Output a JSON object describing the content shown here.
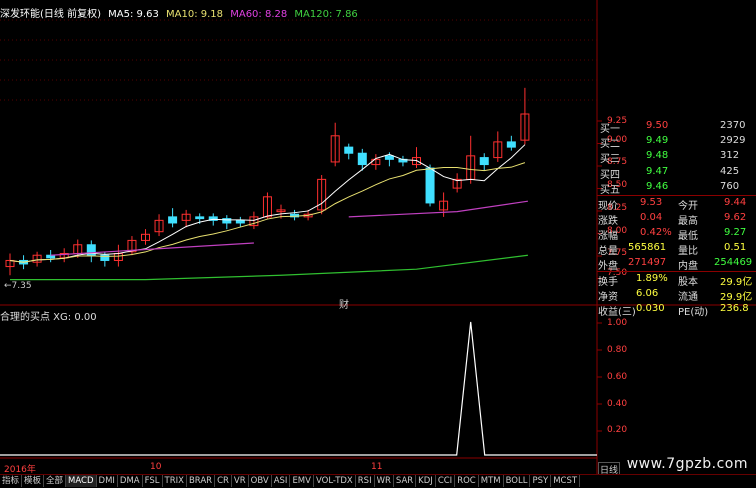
{
  "header": {
    "title": "深发环能(日线 前复权)",
    "ma5": "MA5: 9.63",
    "ma10": "MA10: 9.18",
    "ma60": "MA60: 8.28",
    "ma120": "MA120: 7.86"
  },
  "colors": {
    "up": "#ff3030",
    "down": "#40e0ff",
    "ma5": "#ffffff",
    "ma10": "#e8e070",
    "ma60": "#c040c0",
    "ma120": "#30c030",
    "grid": "#8b0000"
  },
  "price_axis": [
    "9.25",
    "9.00",
    "8.75",
    "8.50",
    "8.25",
    "8.00",
    "7.75",
    "7.50"
  ],
  "low_marker": "←7.35",
  "cai_label": "财",
  "indicator": {
    "title": "合理的买点 XG: 0.00",
    "axis": [
      "1.00",
      "0.80",
      "0.60",
      "0.40",
      "0.20"
    ]
  },
  "date_axis": {
    "year": "2016年",
    "m10": "10",
    "m11": "11"
  },
  "quote": {
    "bids": [
      {
        "label": "买一",
        "price": "9.50",
        "vol": "2370"
      },
      {
        "label": "买二",
        "price": "9.49",
        "vol": "2929"
      },
      {
        "label": "买三",
        "price": "9.48",
        "vol": "312"
      },
      {
        "label": "买四",
        "price": "9.47",
        "vol": "425"
      },
      {
        "label": "买五",
        "price": "9.46",
        "vol": "760"
      }
    ],
    "stats": [
      {
        "l1": "现价",
        "v1": "9.53",
        "l2": "今开",
        "v2": "9.44"
      },
      {
        "l1": "涨跌",
        "v1": "0.04",
        "l2": "最高",
        "v2": "9.62"
      },
      {
        "l1": "涨幅",
        "v1": "0.42%",
        "l2": "最低",
        "v2": "9.27"
      },
      {
        "l1": "总量",
        "v1": "565861",
        "l2": "量比",
        "v2": "0.51"
      },
      {
        "l1": "外盘",
        "v1": "271497",
        "l2": "内盘",
        "v2": "254469"
      }
    ],
    "stats2": [
      {
        "l1": "换手",
        "v1": "1.89%",
        "l2": "股本",
        "v2": "29.9亿"
      },
      {
        "l1": "净资",
        "v1": "6.06",
        "l2": "流通",
        "v2": "29.9亿"
      },
      {
        "l1": "收益(三)",
        "v1": "0.030",
        "l2": "PE(动)",
        "v2": "236.8"
      }
    ]
  },
  "tabs": [
    "指标",
    "模板",
    "全部",
    "MACD",
    "DMI",
    "DMA",
    "FSL",
    "TRIX",
    "BRAR",
    "CR",
    "VR",
    "OBV",
    "ASI",
    "EMV",
    "VOL-TDX",
    "RSI",
    "WR",
    "SAR",
    "KDJ",
    "CCI",
    "ROC",
    "MTM",
    "BOLL",
    "PSY",
    "MCST"
  ],
  "side_tab": "日线",
  "watermark": "www.7gpzb.com",
  "chart_data": {
    "type": "candlestick",
    "candles": [
      {
        "o": 7.55,
        "c": 7.62,
        "h": 7.7,
        "l": 7.45
      },
      {
        "o": 7.62,
        "c": 7.58,
        "h": 7.68,
        "l": 7.52
      },
      {
        "o": 7.6,
        "c": 7.68,
        "h": 7.72,
        "l": 7.55
      },
      {
        "o": 7.68,
        "c": 7.65,
        "h": 7.74,
        "l": 7.6
      },
      {
        "o": 7.65,
        "c": 7.7,
        "h": 7.76,
        "l": 7.6
      },
      {
        "o": 7.7,
        "c": 7.8,
        "h": 7.86,
        "l": 7.65
      },
      {
        "o": 7.8,
        "c": 7.68,
        "h": 7.85,
        "l": 7.6
      },
      {
        "o": 7.68,
        "c": 7.62,
        "h": 7.72,
        "l": 7.55
      },
      {
        "o": 7.62,
        "c": 7.7,
        "h": 7.8,
        "l": 7.55
      },
      {
        "o": 7.72,
        "c": 7.85,
        "h": 7.9,
        "l": 7.68
      },
      {
        "o": 7.85,
        "c": 7.92,
        "h": 7.98,
        "l": 7.8
      },
      {
        "o": 7.95,
        "c": 8.08,
        "h": 8.15,
        "l": 7.9
      },
      {
        "o": 8.12,
        "c": 8.05,
        "h": 8.22,
        "l": 8.0
      },
      {
        "o": 8.08,
        "c": 8.15,
        "h": 8.2,
        "l": 8.0
      },
      {
        "o": 8.12,
        "c": 8.1,
        "h": 8.16,
        "l": 8.04
      },
      {
        "o": 8.12,
        "c": 8.08,
        "h": 8.16,
        "l": 8.02
      },
      {
        "o": 8.1,
        "c": 8.05,
        "h": 8.14,
        "l": 7.98
      },
      {
        "o": 8.08,
        "c": 8.05,
        "h": 8.12,
        "l": 8.0
      },
      {
        "o": 8.02,
        "c": 8.12,
        "h": 8.18,
        "l": 7.98
      },
      {
        "o": 8.12,
        "c": 8.35,
        "h": 8.4,
        "l": 8.1
      },
      {
        "o": 8.18,
        "c": 8.2,
        "h": 8.26,
        "l": 8.1
      },
      {
        "o": 8.15,
        "c": 8.12,
        "h": 8.2,
        "l": 8.08
      },
      {
        "o": 8.12,
        "c": 8.15,
        "h": 8.2,
        "l": 8.08
      },
      {
        "o": 8.2,
        "c": 8.55,
        "h": 8.6,
        "l": 8.15
      },
      {
        "o": 8.75,
        "c": 9.05,
        "h": 9.2,
        "l": 8.7
      },
      {
        "o": 8.92,
        "c": 8.85,
        "h": 8.96,
        "l": 8.78
      },
      {
        "o": 8.85,
        "c": 8.72,
        "h": 8.9,
        "l": 8.65
      },
      {
        "o": 8.72,
        "c": 8.78,
        "h": 8.84,
        "l": 8.66
      },
      {
        "o": 8.82,
        "c": 8.78,
        "h": 8.86,
        "l": 8.7
      },
      {
        "o": 8.78,
        "c": 8.75,
        "h": 8.82,
        "l": 8.7
      },
      {
        "o": 8.72,
        "c": 8.8,
        "h": 8.92,
        "l": 8.68
      },
      {
        "o": 8.68,
        "c": 8.28,
        "h": 8.72,
        "l": 8.24
      },
      {
        "o": 8.2,
        "c": 8.3,
        "h": 8.4,
        "l": 8.12
      },
      {
        "o": 8.45,
        "c": 8.55,
        "h": 8.62,
        "l": 8.4
      },
      {
        "o": 8.55,
        "c": 8.82,
        "h": 9.05,
        "l": 8.5
      },
      {
        "o": 8.8,
        "c": 8.72,
        "h": 8.85,
        "l": 8.65
      },
      {
        "o": 8.8,
        "c": 8.98,
        "h": 9.1,
        "l": 8.75
      },
      {
        "o": 8.98,
        "c": 8.92,
        "h": 9.05,
        "l": 8.88
      },
      {
        "o": 9.0,
        "c": 9.3,
        "h": 9.6,
        "l": 8.95
      }
    ],
    "ylim": [
      7.35,
      9.3
    ],
    "indicator_series": {
      "name": "XG",
      "spike_index": 34,
      "value": 1.0,
      "ylim": [
        0,
        1.0
      ]
    }
  }
}
